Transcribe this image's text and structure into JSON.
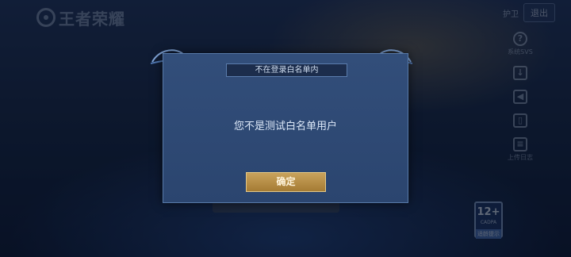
{
  "header": {
    "logo_text": "王者荣耀",
    "top_right_text": "护卫",
    "exit_label": "退出"
  },
  "sidebar": {
    "items": [
      {
        "icon": "question-icon",
        "label": "系统SVS"
      },
      {
        "icon": "download-icon",
        "label": ""
      },
      {
        "icon": "volume-icon",
        "label": ""
      },
      {
        "icon": "phone-icon",
        "label": ""
      },
      {
        "icon": "log-icon",
        "label": "上传日志"
      }
    ]
  },
  "age_badge": {
    "rating": "12+",
    "sub": "CADPA",
    "foot": "适龄提示"
  },
  "dialog": {
    "title": "不在登录白名单内",
    "message": "您不是测试白名单用户",
    "confirm_label": "确定"
  },
  "colors": {
    "dialog_bg": "#2f4a76",
    "button_gold": "#b88d45",
    "border_blue": "#587aa8"
  }
}
